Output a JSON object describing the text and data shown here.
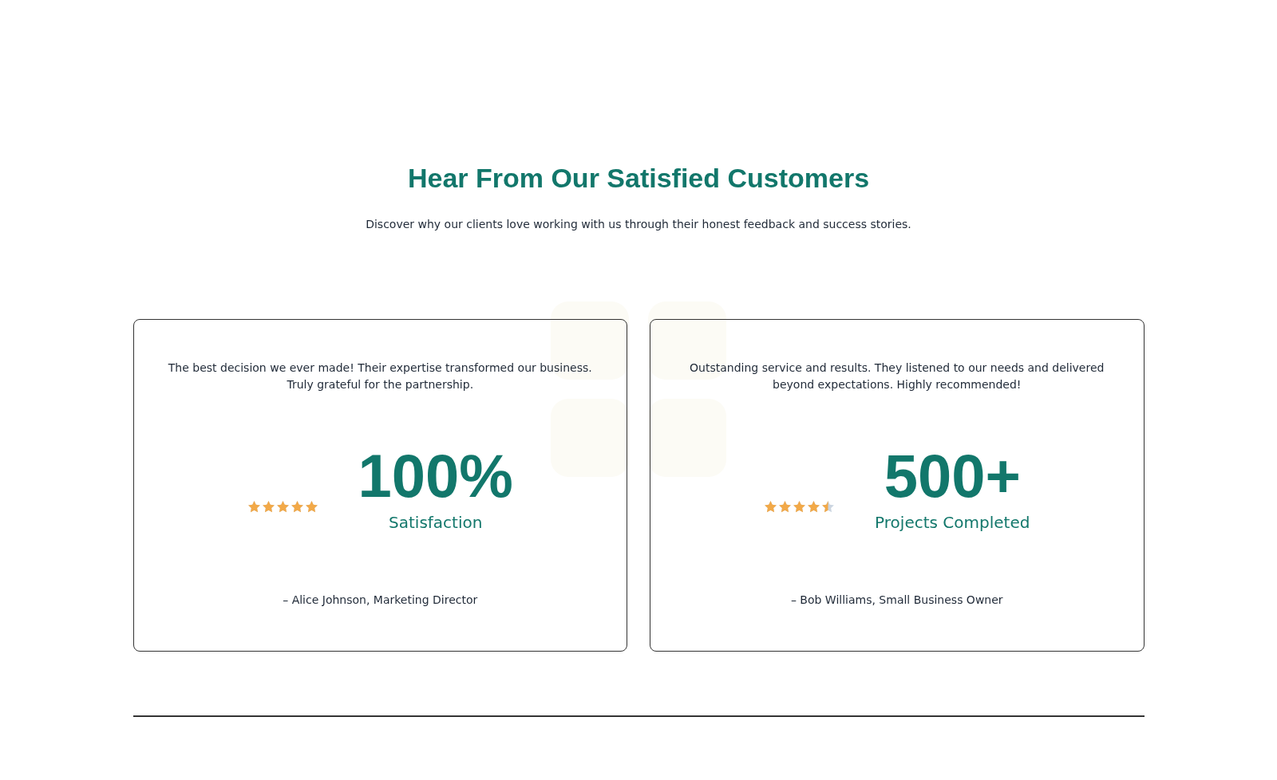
{
  "heading": "Hear From Our Satisfied Customers",
  "subtitle": "Discover why our clients love working with us through their honest feedback and success stories.",
  "testimonials": [
    {
      "quote": "The best decision we ever made! Their expertise transformed our business. Truly grateful for the partnership.",
      "stars": 5,
      "stat": "100%",
      "stat_label": "Satisfaction",
      "author": "– Alice Johnson, Marketing Director"
    },
    {
      "quote": "Outstanding service and results. They listened to our needs and delivered beyond expectations. Highly recommended!",
      "stars": 4.5,
      "stat": "500+",
      "stat_label": "Projects Completed",
      "author": "– Bob Williams, Small Business Owner"
    }
  ]
}
